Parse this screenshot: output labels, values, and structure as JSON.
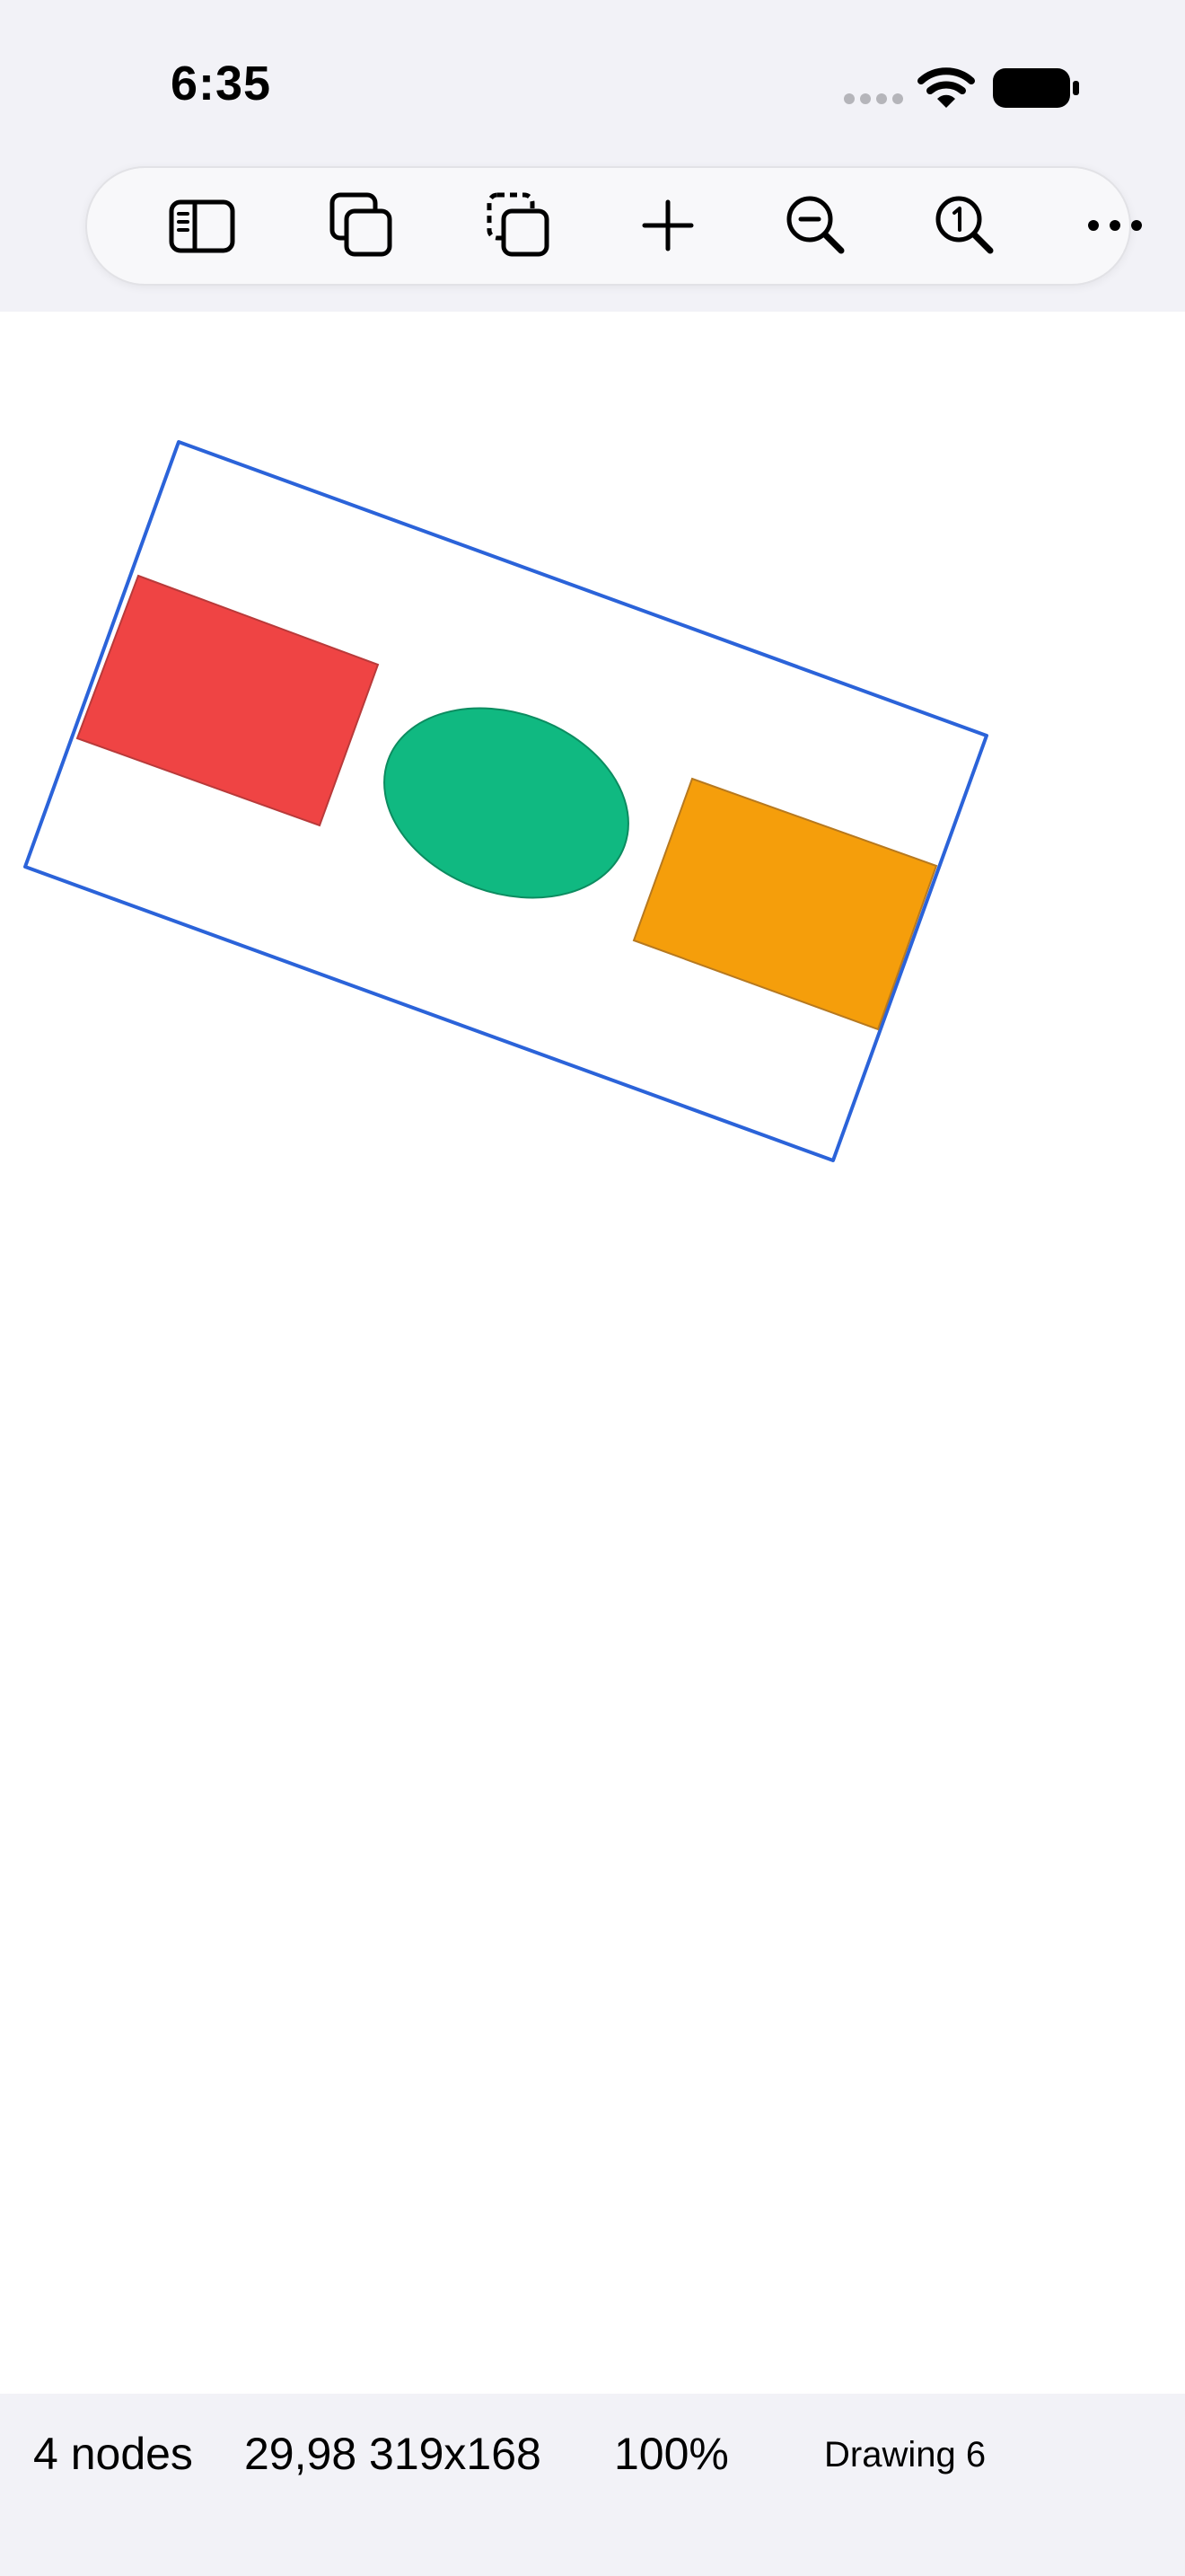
{
  "status_bar": {
    "time": "6:35"
  },
  "toolbar": {
    "buttons": [
      {
        "name": "sidebar-toggle",
        "icon": "sidebar-icon"
      },
      {
        "name": "duplicate",
        "icon": "duplicate-icon"
      },
      {
        "name": "copy-selection",
        "icon": "dashed-copy-icon"
      },
      {
        "name": "add",
        "icon": "plus-icon"
      },
      {
        "name": "zoom-out",
        "icon": "zoom-out-icon"
      },
      {
        "name": "zoom-reset",
        "icon": "zoom-one-icon"
      },
      {
        "name": "more",
        "icon": "ellipsis-icon"
      }
    ]
  },
  "canvas": {
    "nodes": [
      {
        "type": "group",
        "selected": true,
        "stroke": "#2b63d9"
      },
      {
        "type": "rectangle",
        "fill": "#ef4444",
        "stroke": "#b93a3a"
      },
      {
        "type": "ellipse",
        "fill": "#10b981",
        "stroke": "#0c8c60"
      },
      {
        "type": "rectangle",
        "fill": "#f59e0b",
        "stroke": "#b7791f"
      }
    ]
  },
  "footer": {
    "node_count": "4 nodes",
    "geometry": "29,98 319x168",
    "zoom": "100%",
    "document_name": "Drawing 6"
  }
}
